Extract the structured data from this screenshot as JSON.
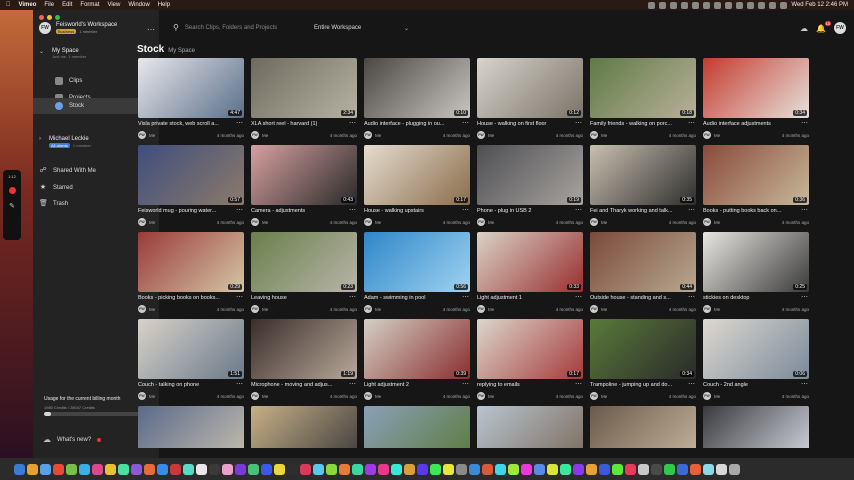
{
  "menubar": {
    "app": "Vimeo",
    "items": [
      "File",
      "Edit",
      "Format",
      "View",
      "Window",
      "Help"
    ],
    "clock": "Wed Feb 12  2:46 PM"
  },
  "floatbar": {
    "time": "1:12"
  },
  "sidebar": {
    "workspace": {
      "name": "Feisworld's Workspace",
      "avatar": "FW",
      "plan": "Business",
      "members": "1 member"
    },
    "space": {
      "name": "My Space",
      "sub": "Just me, 1 member"
    },
    "items": [
      {
        "label": "Clips"
      },
      {
        "label": "Projects"
      },
      {
        "label": "Stock"
      }
    ],
    "member": {
      "name": "Michael Leckie",
      "badge": "All clients",
      "sub": "1 member"
    },
    "sections": [
      {
        "label": "Shared With Me"
      },
      {
        "label": "Starred"
      },
      {
        "label": "Trash"
      }
    ],
    "usage": {
      "title": "Usage for the current billing month",
      "credits": "1980 Credits / 28047 Credits",
      "fraction": 0.07
    },
    "whats_new": "What's new?"
  },
  "topbar": {
    "search_placeholder": "Search Clips, Folders and Projects",
    "scope": "Entire Workspace",
    "notif_count": "10",
    "avatar": "FW"
  },
  "breadcrumb": {
    "current": "Stock",
    "parent": "My Space"
  },
  "owner": "Me",
  "owner_avatar": "FW",
  "clips": [
    {
      "title": "Visla private stock, web scroll a...",
      "duration": "4:47",
      "ago": "4 months ago",
      "colors": [
        "#e8e8ea",
        "#5b6f8a"
      ]
    },
    {
      "title": "XLA short reel - harvard (1)",
      "duration": "2:34",
      "ago": "4 months ago",
      "colors": [
        "#6d6a5e",
        "#b7b3a3"
      ]
    },
    {
      "title": "Audio interface - plugging in ou...",
      "duration": "0:10",
      "ago": "4 months ago",
      "colors": [
        "#4a4744",
        "#c9c5c0"
      ]
    },
    {
      "title": "House - walking on first floor",
      "duration": "0:12",
      "ago": "4 months ago",
      "colors": [
        "#d8d4cc",
        "#7a7468"
      ]
    },
    {
      "title": "Family friends - walking on porc...",
      "duration": "0:18",
      "ago": "4 months ago",
      "colors": [
        "#5f7a45",
        "#b9b09a"
      ]
    },
    {
      "title": "Audio interface adjustments",
      "duration": "0:34",
      "ago": "4 months ago",
      "colors": [
        "#c53a2e",
        "#e6e2dc"
      ]
    },
    {
      "title": "Feisworld mug - pouring water...",
      "duration": "0:57",
      "ago": "4 months ago",
      "colors": [
        "#3f4e7e",
        "#8b7a6a"
      ]
    },
    {
      "title": "Camera - adjustments",
      "duration": "0:43",
      "ago": "4 months ago",
      "colors": [
        "#d7a0a0",
        "#2a2a2a"
      ]
    },
    {
      "title": "House - walking upstairs",
      "duration": "0:17",
      "ago": "4 months ago",
      "colors": [
        "#e4ddd0",
        "#8b6c4a"
      ]
    },
    {
      "title": "Phone - plug in USB 2",
      "duration": "0:19",
      "ago": "4 months ago",
      "colors": [
        "#4e4e52",
        "#a8a4a0"
      ]
    },
    {
      "title": "Fei and Tharyk working and talk...",
      "duration": "0:35",
      "ago": "4 months ago",
      "colors": [
        "#c8c0b0",
        "#2e2e2e"
      ]
    },
    {
      "title": "Books - putting books back on...",
      "duration": "0:36",
      "ago": "4 months ago",
      "colors": [
        "#8a4a3a",
        "#c7b89a"
      ]
    },
    {
      "title": "Books - picking books on books...",
      "duration": "0:29",
      "ago": "4 months ago",
      "colors": [
        "#9a3a3a",
        "#d5c6a5"
      ]
    },
    {
      "title": "Leaving house",
      "duration": "0:23",
      "ago": "4 months ago",
      "colors": [
        "#6a7f4a",
        "#b8b4aa"
      ]
    },
    {
      "title": "Adam - swimming in pool",
      "duration": "0:56",
      "ago": "4 months ago",
      "colors": [
        "#2e86c9",
        "#9fd3f0"
      ]
    },
    {
      "title": "Light adjustment 1",
      "duration": "0:33",
      "ago": "4 months ago",
      "colors": [
        "#d9d3c8",
        "#9a2e2e"
      ]
    },
    {
      "title": "Outside house - standing and s...",
      "duration": "0:44",
      "ago": "4 months ago",
      "colors": [
        "#7a4a3a",
        "#b8a890"
      ]
    },
    {
      "title": "stickies on desktop",
      "duration": "0:25",
      "ago": "4 months ago",
      "colors": [
        "#e8e6e2",
        "#3a3a3a"
      ]
    },
    {
      "title": "Couch - talking on phone",
      "duration": "1:51",
      "ago": "4 months ago",
      "colors": [
        "#d8d2c8",
        "#6a7a8a"
      ]
    },
    {
      "title": "Microphone - moving and adjus...",
      "duration": "1:19",
      "ago": "4 months ago",
      "colors": [
        "#3a2e2a",
        "#b8a89a"
      ]
    },
    {
      "title": "Light adjustment 2",
      "duration": "0:39",
      "ago": "4 months ago",
      "colors": [
        "#d4cfc6",
        "#8a2e2e"
      ]
    },
    {
      "title": "replying to emails",
      "duration": "0:17",
      "ago": "4 months ago",
      "colors": [
        "#dcd6cc",
        "#a63a3a"
      ]
    },
    {
      "title": "Trampoline - jumping up and do...",
      "duration": "0:34",
      "ago": "4 months ago",
      "colors": [
        "#5a7a3a",
        "#2a2a2a"
      ]
    },
    {
      "title": "Couch - 2nd angle",
      "duration": "0:06",
      "ago": "4 months ago",
      "colors": [
        "#ddd8cf",
        "#7a8a9a"
      ]
    },
    {
      "title": "",
      "duration": "",
      "ago": "",
      "colors": [
        "#5a6a8a",
        "#c8c0b0"
      ]
    },
    {
      "title": "",
      "duration": "",
      "ago": "",
      "colors": [
        "#c8b088",
        "#3a3a3a"
      ]
    },
    {
      "title": "",
      "duration": "",
      "ago": "",
      "colors": [
        "#8aa0b8",
        "#5a7a3a"
      ]
    },
    {
      "title": "",
      "duration": "",
      "ago": "",
      "colors": [
        "#b8c4d0",
        "#7a6a5a"
      ]
    },
    {
      "title": "",
      "duration": "",
      "ago": "",
      "colors": [
        "#6a5a4a",
        "#c8b8a0"
      ]
    },
    {
      "title": "",
      "duration": "",
      "ago": "",
      "colors": [
        "#3a3a3e",
        "#d8dce4"
      ]
    }
  ],
  "dock_colors": [
    "#3a7bd5",
    "#e8a030",
    "#5aa0e8",
    "#e84a3a",
    "#7ac048",
    "#3ab0e8",
    "#d84a8a",
    "#e8c030",
    "#4ae0a0",
    "#8a5ad8",
    "#e86a3a",
    "#3a8ae8",
    "#c83a3a",
    "#5ad8c8",
    "#e8e8e8",
    "#3a3a3a",
    "#e8a0c8",
    "#7a3ad8",
    "#48c07a",
    "#3a5ae8",
    "#e8d83a",
    "#2e2e2e",
    "#d83a5a",
    "#5ac8e8",
    "#8ad83a",
    "#e87a3a",
    "#3ad8a0",
    "#a03ae8",
    "#e83a8a",
    "#3ae8d8",
    "#d8a03a",
    "#5a3ae8",
    "#3ae85a",
    "#e8e83a",
    "#8a8a8a",
    "#3a8ad8",
    "#d85a3a",
    "#3ad8e8",
    "#a0e83a",
    "#e83ad8",
    "#5a8ae8",
    "#d8e83a",
    "#3ae8a0",
    "#8a3ae8",
    "#e8a03a",
    "#3a5ad8",
    "#5ae83a",
    "#e83a5a",
    "#c8c8c8",
    "#4a4a4a",
    "#2ec84a",
    "#3a6ad8",
    "#e8603a",
    "#8ad8e8",
    "#d8d8d8",
    "#aaaaaa"
  ]
}
